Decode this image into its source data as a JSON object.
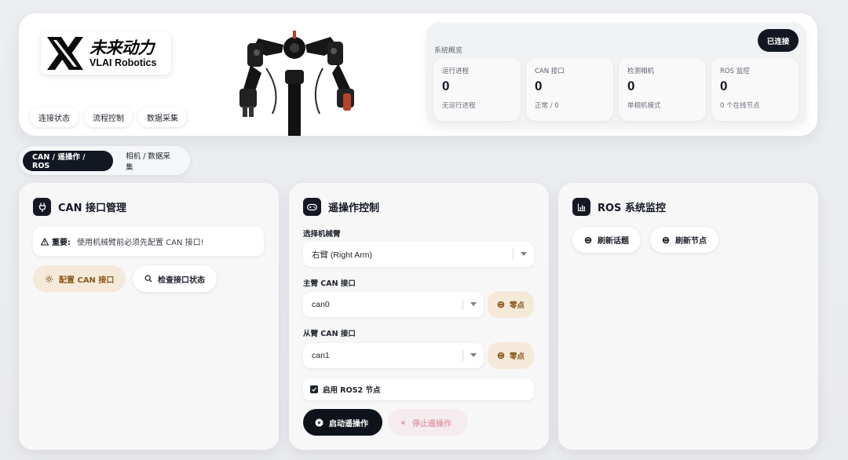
{
  "brand": {
    "name_cn": "未来动力",
    "name_en": "VLAI Robotics"
  },
  "hero_tabs": [
    "连接状态",
    "流程控制",
    "数据采集"
  ],
  "overview": {
    "title": "系统概览",
    "status_button": "已连接",
    "cards": [
      {
        "label": "运行进程",
        "value": "0",
        "sub": "无运行进程"
      },
      {
        "label": "CAN 接口",
        "value": "0",
        "sub": "正常 / 0"
      },
      {
        "label": "检测相机",
        "value": "0",
        "sub": "单相机模式"
      },
      {
        "label": "ROS 监控",
        "value": "0",
        "sub": "0 个在线节点"
      }
    ]
  },
  "main_tabs": [
    {
      "label": "CAN / 遥操作 / ROS",
      "active": true
    },
    {
      "label": "相机 / 数据采集",
      "active": false
    }
  ],
  "can_panel": {
    "title": "CAN 接口管理",
    "notice_strong": "重要:",
    "notice_text": "使用机械臂前必须先配置 CAN 接口!",
    "configure_button": "配置 CAN 接口",
    "check_button": "检查接口状态"
  },
  "teleop_panel": {
    "title": "遥操作控制",
    "arm_label": "选择机械臂",
    "arm_value": "右臂 (Right Arm)",
    "master_label": "主臂 CAN 接口",
    "master_value": "can0",
    "zero_label": "零点",
    "slave_label": "从臂 CAN 接口",
    "slave_value": "can1",
    "ros2_label": "启用 ROS2 节点",
    "ros2_checked": true,
    "start_button": "启动遥操作",
    "stop_button": "停止遥操作"
  },
  "ros_panel": {
    "title": "ROS 系统监控",
    "refresh_topics": "刷新话题",
    "refresh_nodes": "刷新节点"
  },
  "colors": {
    "dark": "#121722",
    "warm_button": "#f5e9d9",
    "warm_text": "#8a5a1e",
    "stop_text": "#e2a4b1"
  },
  "icons": [
    "logo-x-icon",
    "robot-arm-image",
    "plug-icon",
    "gamepad-icon",
    "chart-icon",
    "warning-icon",
    "gear-icon",
    "search-icon",
    "refresh-icon",
    "play-icon",
    "stop-icon",
    "check-icon",
    "chevron-down-icon"
  ]
}
